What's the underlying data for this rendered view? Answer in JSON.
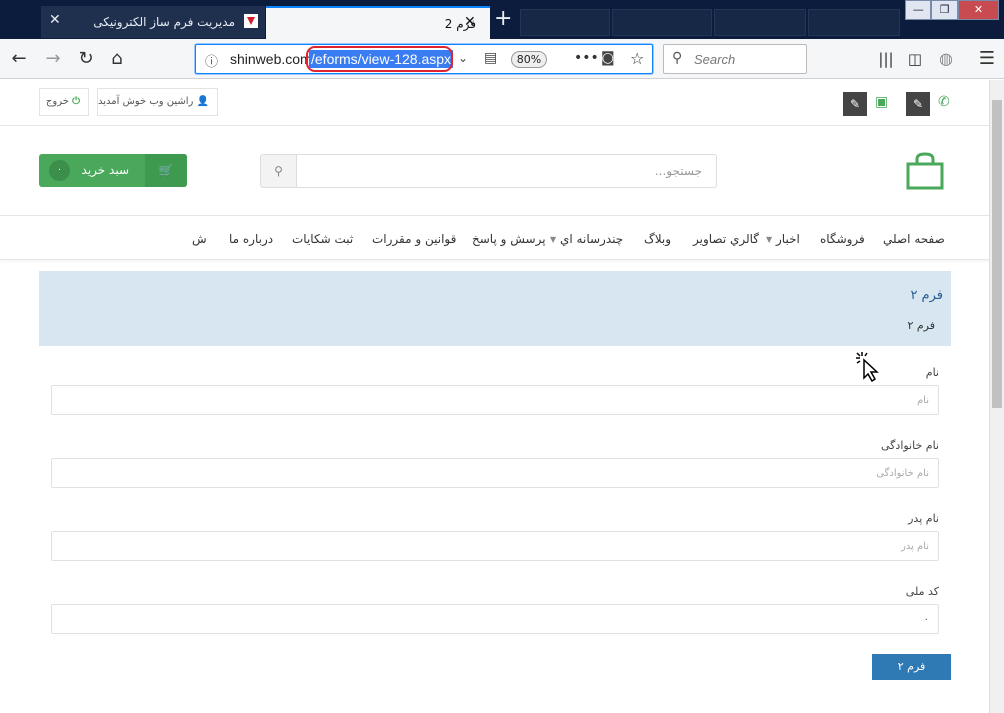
{
  "browser": {
    "tabs": [
      {
        "title": "مدیریت فرم ساز الکترونیکی",
        "active": false
      },
      {
        "title": "فرم 2",
        "active": true
      }
    ],
    "url_host": "shinweb.com",
    "url_path": "/eforms/view-128.aspx",
    "zoom": "80%",
    "search_placeholder": "Search",
    "accent": "#0a84ff"
  },
  "site": {
    "logout_label": "خروج",
    "welcome_label": "راشین وب خوش آمدید",
    "cart_label": "سبد خرید",
    "cart_count": "۰",
    "search_placeholder": "جستجو...",
    "brand_color": "#4aa85b",
    "menu": [
      "صفحه اصلي",
      "فروشگاه",
      "اخبار",
      "گالري تصاوير",
      "وبلاگ",
      "چندرسانه اي",
      "پرسش و پاسخ",
      "قوانين و مقررات",
      "ثبت شكايات",
      "درباره ما",
      "ش"
    ]
  },
  "form": {
    "title": "فرم ۲",
    "subtitle": "فرم ۲",
    "fields": [
      {
        "label": "نام",
        "placeholder": "نام"
      },
      {
        "label": "نام خانوادگی",
        "placeholder": "نام خانوادگی"
      },
      {
        "label": "نام پدر",
        "placeholder": "نام پدر"
      },
      {
        "label": "کد ملی",
        "value": "۰"
      }
    ],
    "submit_label": "فرم ۲"
  }
}
